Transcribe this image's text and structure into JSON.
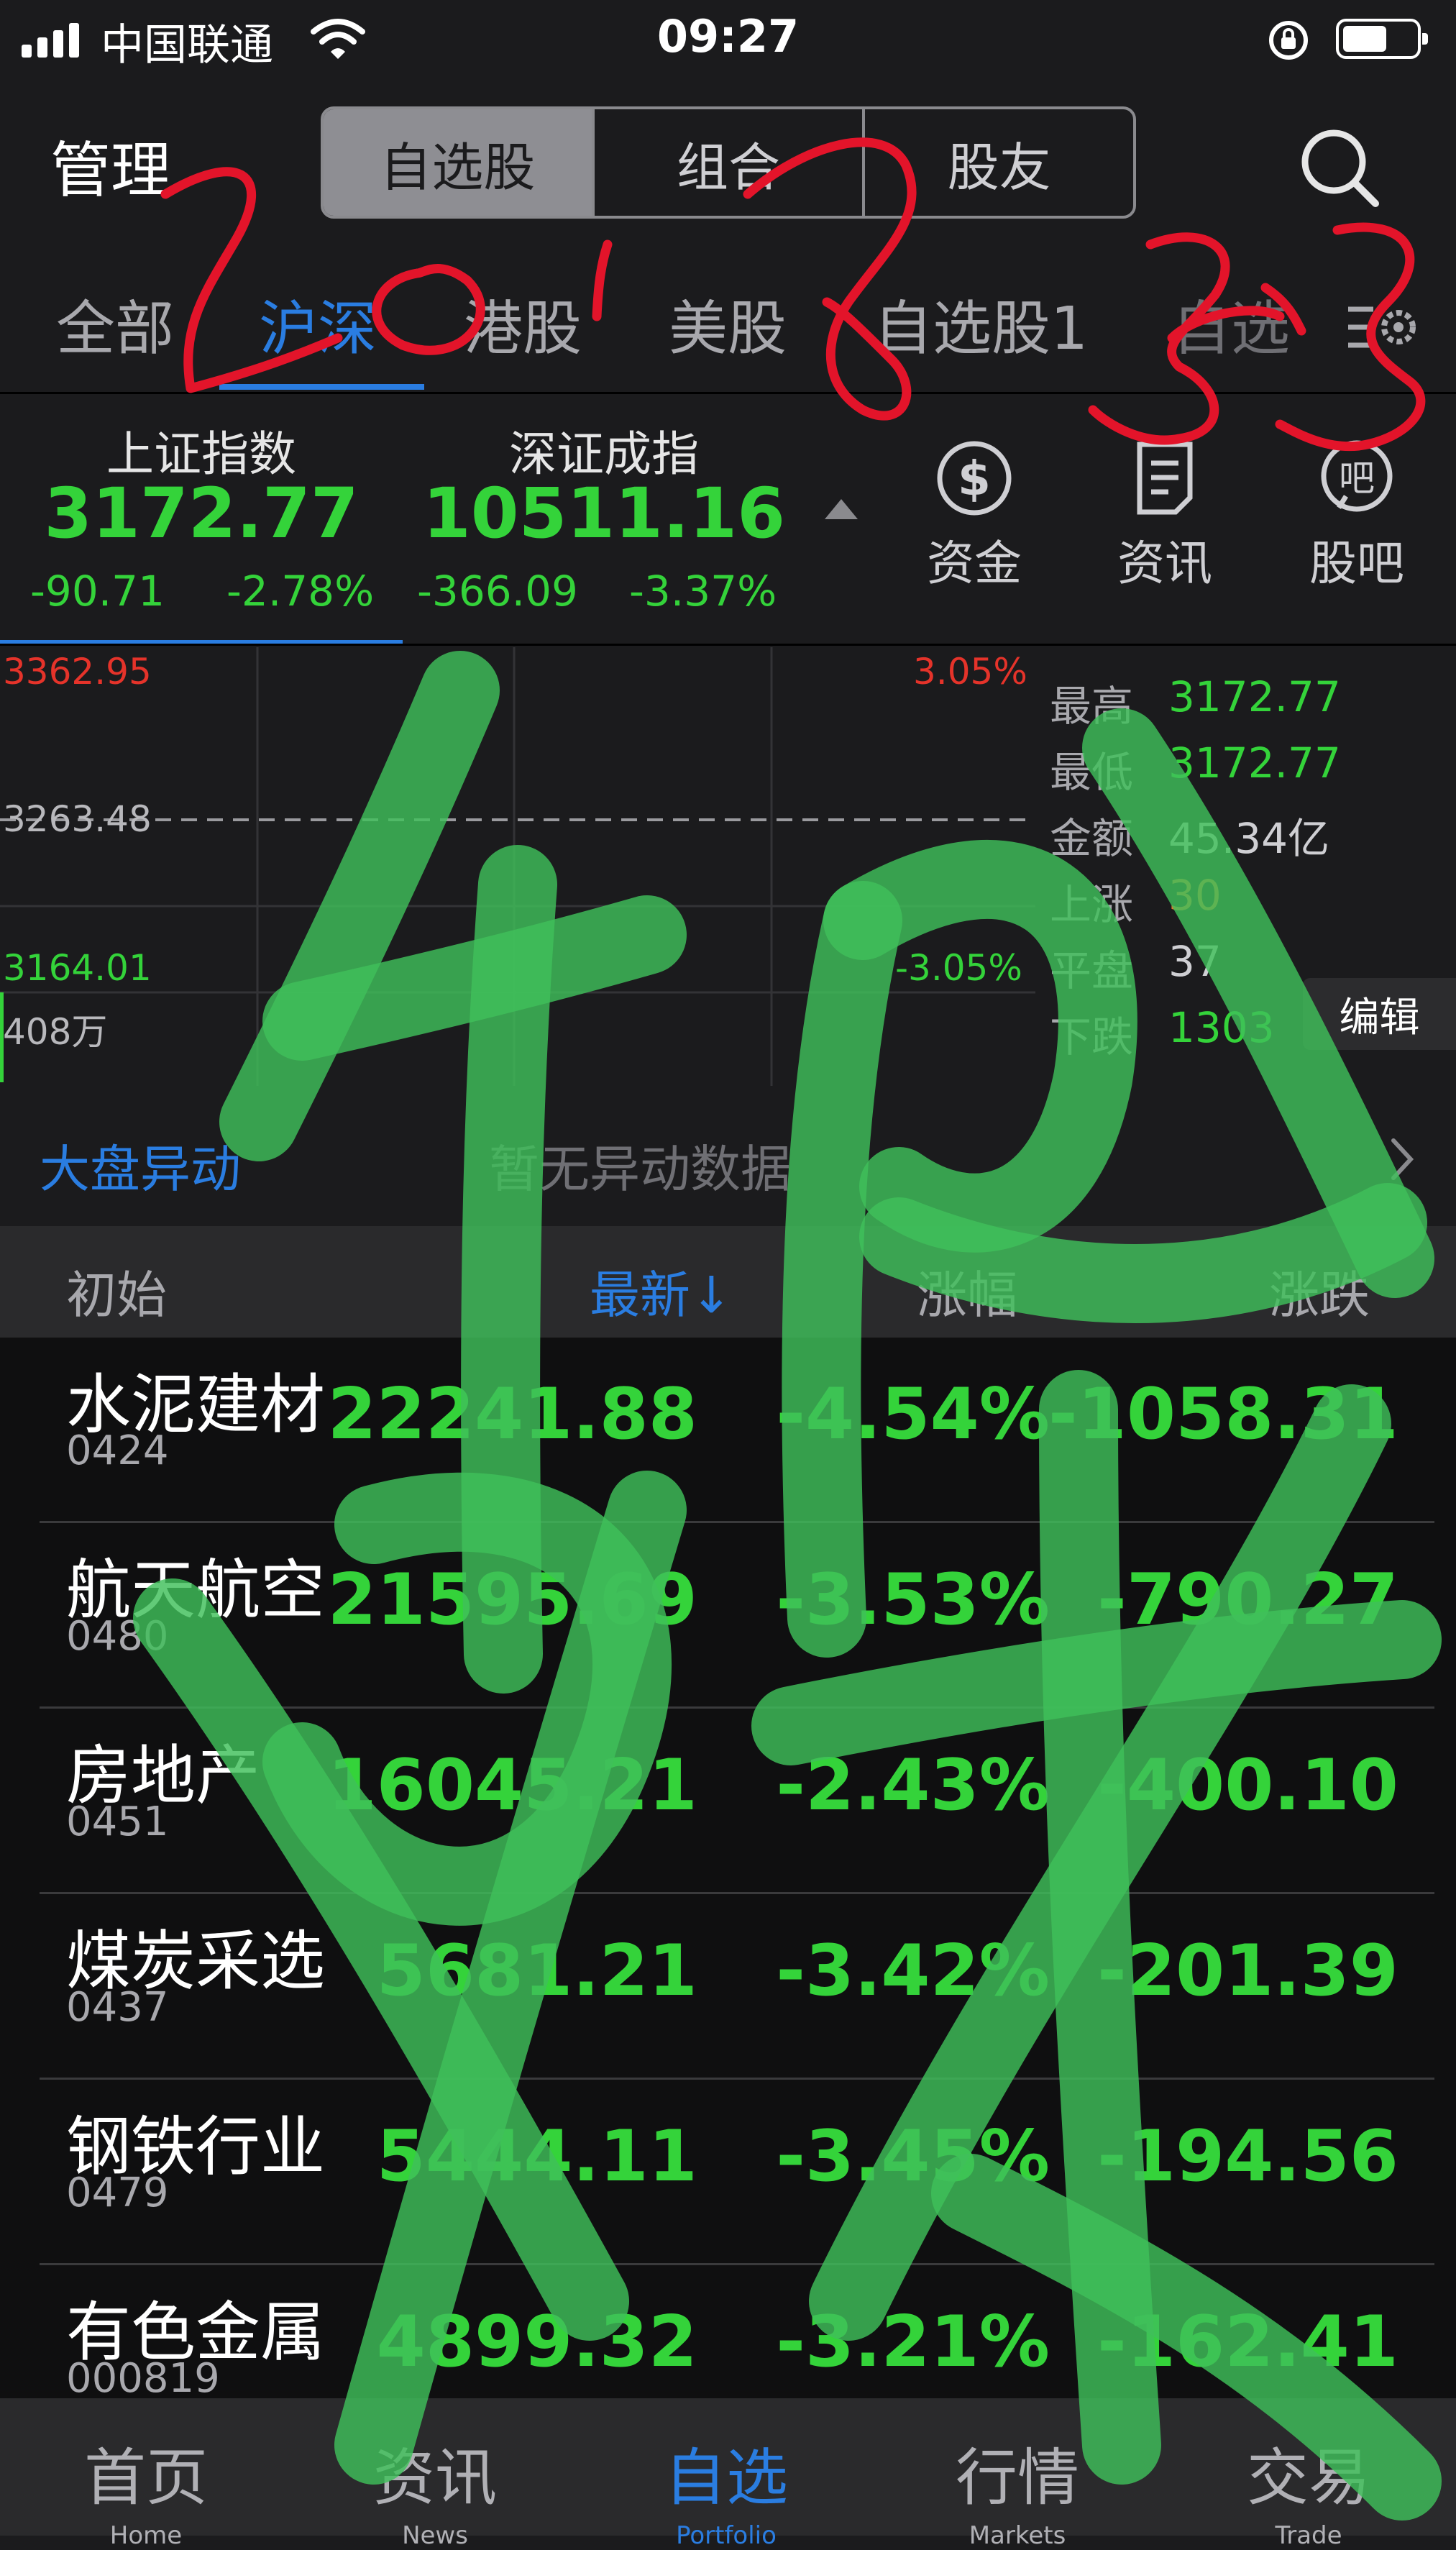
{
  "status_bar": {
    "carrier": "中国联通",
    "time": "09:27"
  },
  "header": {
    "manage": "管理",
    "segments": [
      "自选股",
      "组合",
      "股友"
    ]
  },
  "tabs": [
    "全部",
    "沪深",
    "港股",
    "美股",
    "自选股1",
    "自选"
  ],
  "indices": [
    {
      "name": "上证指数",
      "value": "3172.77",
      "change": "-90.71",
      "pct": "-2.78%"
    },
    {
      "name": "深证成指",
      "value": "10511.16",
      "change": "-366.09",
      "pct": "-3.37%"
    }
  ],
  "tools": [
    {
      "label": "资金",
      "icon": "dollar-icon"
    },
    {
      "label": "资讯",
      "icon": "news-icon"
    },
    {
      "label": "股吧",
      "icon": "forum-icon"
    }
  ],
  "chart": {
    "high_label": "3362.95",
    "mid_label": "3263.48",
    "low_label": "3164.01",
    "pct_high": "3.05%",
    "pct_low": "-3.05%",
    "volume_label": "408万",
    "stats": {
      "high_label": "最高",
      "high": "3172.77",
      "low_label": "最低",
      "low": "3172.77",
      "amount_label": "金额",
      "amount": "45.34亿",
      "up_label": "上涨",
      "up": "30",
      "flat_label": "平盘",
      "flat": "37",
      "down_label": "下跌",
      "down": "1303"
    },
    "edit_label": "编辑"
  },
  "alert": {
    "title": "大盘异动",
    "message": "暂无异动数据"
  },
  "table": {
    "headers": {
      "name": "初始",
      "latest": "最新↓",
      "pct": "涨幅",
      "change": "涨跌"
    },
    "rows": [
      {
        "name": "水泥建材",
        "code": "0424",
        "latest": "22241.88",
        "pct": "-4.54%",
        "change": "-1058.31"
      },
      {
        "name": "航天航空",
        "code": "0480",
        "latest": "21595.69",
        "pct": "-3.53%",
        "change": "-790.27"
      },
      {
        "name": "房地产",
        "code": "0451",
        "latest": "16045.21",
        "pct": "-2.43%",
        "change": "-400.10"
      },
      {
        "name": "煤炭采选",
        "code": "0437",
        "latest": "5681.21",
        "pct": "-3.42%",
        "change": "-201.39"
      },
      {
        "name": "钢铁行业",
        "code": "0479",
        "latest": "5444.11",
        "pct": "-3.45%",
        "change": "-194.56"
      },
      {
        "name": "有色金属",
        "code": "000819",
        "latest": "4899.32",
        "pct": "-3.21%",
        "change": "-162.41"
      }
    ]
  },
  "bottom_nav": [
    {
      "zh": "首页",
      "en": "Home"
    },
    {
      "zh": "资讯",
      "en": "News"
    },
    {
      "zh": "自选",
      "en": "Portfolio"
    },
    {
      "zh": "行情",
      "en": "Markets"
    },
    {
      "zh": "交易",
      "en": "Trade"
    }
  ],
  "annotation": {
    "handwritten_date": "2018.3.23",
    "handwritten_chars": "割肉"
  },
  "colors": {
    "accent": "#2a7de1",
    "down_green": "#34d33a",
    "up_red": "#e5332a",
    "orange": "#e0782c",
    "overlay_green": "#3fbf5a",
    "ink_red": "#e3142a"
  }
}
